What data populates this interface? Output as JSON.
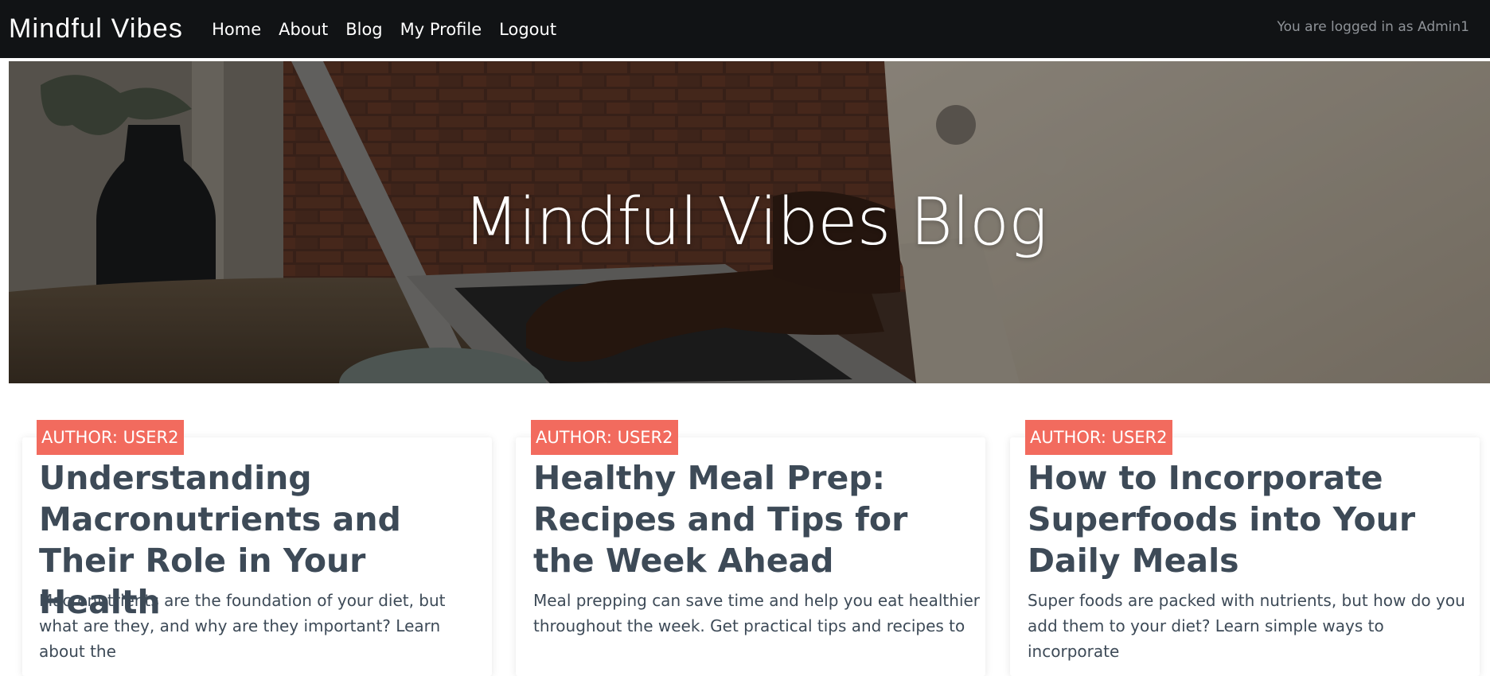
{
  "navbar": {
    "brand": "Mindful Vibes",
    "links": [
      {
        "label": "Home"
      },
      {
        "label": "About"
      },
      {
        "label": "Blog"
      },
      {
        "label": "My Profile"
      },
      {
        "label": "Logout"
      }
    ],
    "status": "You are logged in as Admin1"
  },
  "hero": {
    "title": "Mindful Vibes Blog"
  },
  "posts": [
    {
      "author_badge": "AUTHOR: USER2",
      "title": "Understanding Macronutrients and Their Role in Your Health",
      "excerpt": "Macronutrients are the foundation of your diet, but what are they, and why are they important? Learn about the"
    },
    {
      "author_badge": "AUTHOR: USER2",
      "title": "Healthy Meal Prep: Recipes and Tips for the Week Ahead",
      "excerpt": "Meal prepping can save time and help you eat healthier throughout the week. Get practical tips and recipes to"
    },
    {
      "author_badge": "AUTHOR: USER2",
      "title": "How to Incorporate Superfoods into Your Daily Meals",
      "excerpt": "Super foods are packed with nutrients, but how do you add them to your diet? Learn simple ways to incorporate"
    }
  ],
  "colors": {
    "navbar_bg": "#111315",
    "badge_bg": "#f26b5e",
    "card_text": "#3d4a57",
    "status_text": "#8f9398"
  }
}
